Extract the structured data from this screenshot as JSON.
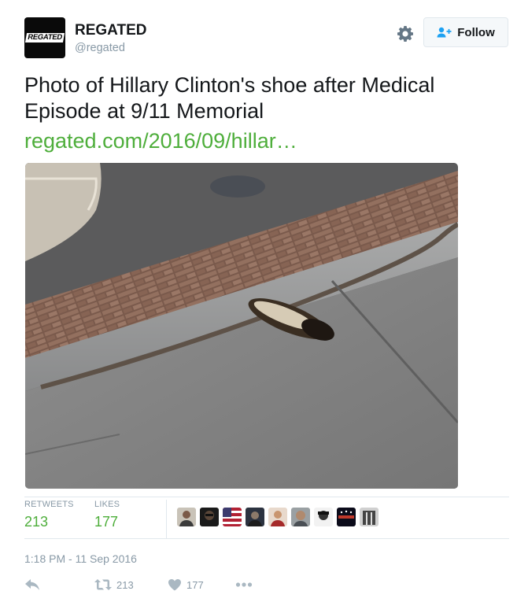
{
  "profile": {
    "avatar_text": "REGATED",
    "name": "REGATED",
    "handle": "@regated"
  },
  "header": {
    "follow_label": "Follow",
    "gear_icon": "gear-icon",
    "follow_icon": "add-user-icon"
  },
  "tweet": {
    "text": "Photo of Hillary Clinton's shoe after Medical Episode at 9/11 Memorial",
    "link": "regated.com/2016/09/hillar…"
  },
  "stats": {
    "retweets_label": "RETWEETS",
    "retweets": "213",
    "likes_label": "LIKES",
    "likes": "177"
  },
  "timestamp": "1:18 PM - 11 Sep 2016",
  "actions": {
    "retweet_count": "213",
    "like_count": "177"
  },
  "colors": {
    "link": "#4eae3b",
    "muted": "#8899a6",
    "border": "#e1e8ed"
  }
}
